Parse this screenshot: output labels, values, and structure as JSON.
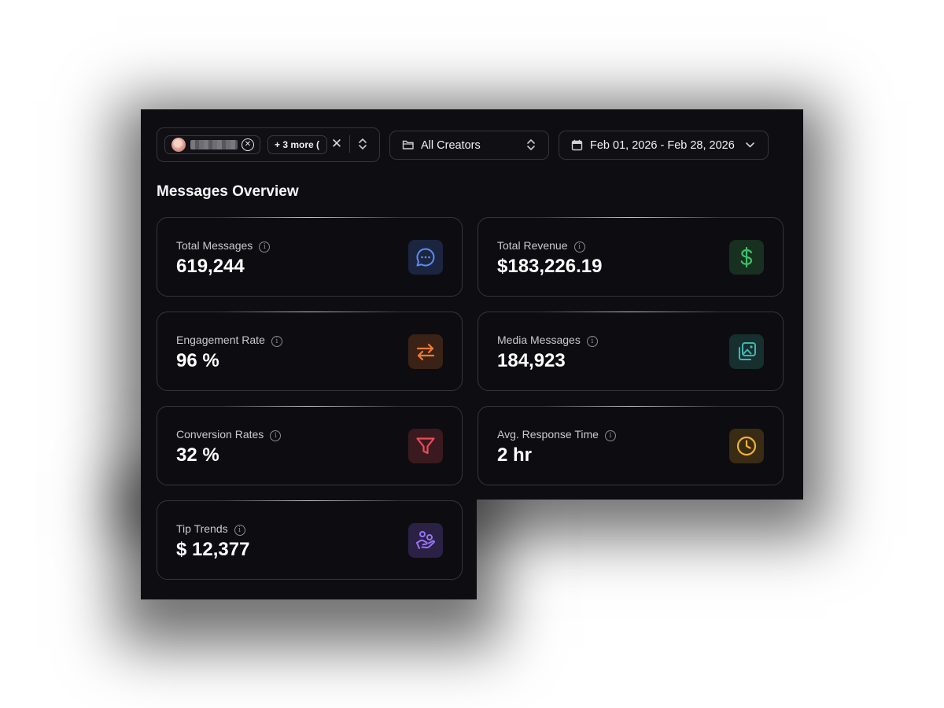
{
  "filters": {
    "creator_chip": {
      "name": "",
      "remove_icon": "x-circle-icon"
    },
    "more_chip": {
      "label": "+ 3 more  ("
    },
    "clear_icon": "close-icon",
    "toggle_icon": "chevron-up-down-icon",
    "creators_dropdown": {
      "label": "All Creators",
      "icon": "folder-icon"
    },
    "date_range": {
      "label": "Feb 01, 2026 - Feb 28, 2026",
      "icon": "calendar-icon"
    }
  },
  "section": {
    "title": "Messages Overview"
  },
  "cards": [
    {
      "title": "Total Messages",
      "value": "619,244",
      "icon": "message-bubble-icon",
      "color": "#5b8cf7",
      "bg": "#1b2540"
    },
    {
      "title": "Total Revenue",
      "value": "$183,226.19",
      "icon": "dollar-icon",
      "color": "#3fbf6a",
      "bg": "#18301f"
    },
    {
      "title": "Engagement Rate",
      "value": "96 %",
      "icon": "arrows-swap-icon",
      "color": "#f07a34",
      "bg": "#3a2316"
    },
    {
      "title": "Media Messages",
      "value": "184,923",
      "icon": "images-icon",
      "color": "#3fb8b0",
      "bg": "#17302f"
    },
    {
      "title": "Conversion Rates",
      "value": "32 %",
      "icon": "funnel-icon",
      "color": "#ec4d58",
      "bg": "#3a1a1f"
    },
    {
      "title": "Avg. Response Time",
      "value": "2 hr",
      "icon": "clock-icon",
      "color": "#f0b234",
      "bg": "#3a2c14"
    },
    {
      "title": "Tip Trends",
      "value": "$ 12,377",
      "icon": "hand-coins-icon",
      "color": "#9a73f2",
      "bg": "#2a2145"
    }
  ]
}
